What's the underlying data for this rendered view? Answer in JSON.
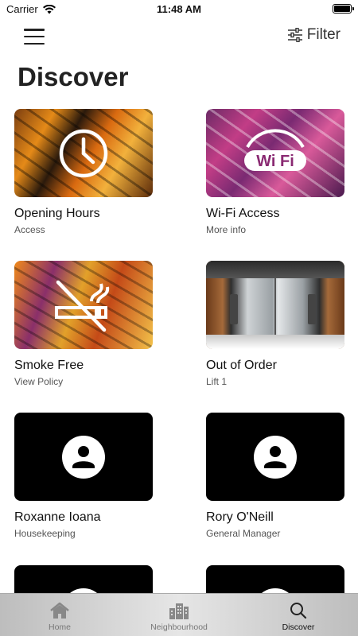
{
  "status": {
    "carrier": "Carrier",
    "time": "11:48 AM"
  },
  "header": {
    "filter_label": "Filter",
    "title": "Discover"
  },
  "cards": [
    {
      "title": "Opening Hours",
      "subtitle": "Access",
      "icon": "clock-icon"
    },
    {
      "title": "Wi-Fi Access",
      "subtitle": "More info",
      "icon": "wifi-icon",
      "icon_text": "Wi Fi"
    },
    {
      "title": "Smoke Free",
      "subtitle": "View Policy",
      "icon": "no-smoking-icon"
    },
    {
      "title": "Out of Order",
      "subtitle": "Lift 1",
      "icon": "elevator-image"
    },
    {
      "title": "Roxanne Ioana",
      "subtitle": "Housekeeping",
      "icon": "person-icon"
    },
    {
      "title": "Rory O'Neill",
      "subtitle": "General Manager",
      "icon": "person-icon"
    },
    {
      "title": "",
      "subtitle": "",
      "icon": "person-icon"
    },
    {
      "title": "",
      "subtitle": "",
      "icon": "person-icon"
    }
  ],
  "tabs": [
    {
      "label": "Home",
      "icon": "home-icon",
      "active": false
    },
    {
      "label": "Neighbourhood",
      "icon": "buildings-icon",
      "active": false
    },
    {
      "label": "Discover",
      "icon": "search-icon",
      "active": true
    }
  ],
  "colors": {
    "accent": "#111111",
    "inactive_tab": "#777777"
  }
}
